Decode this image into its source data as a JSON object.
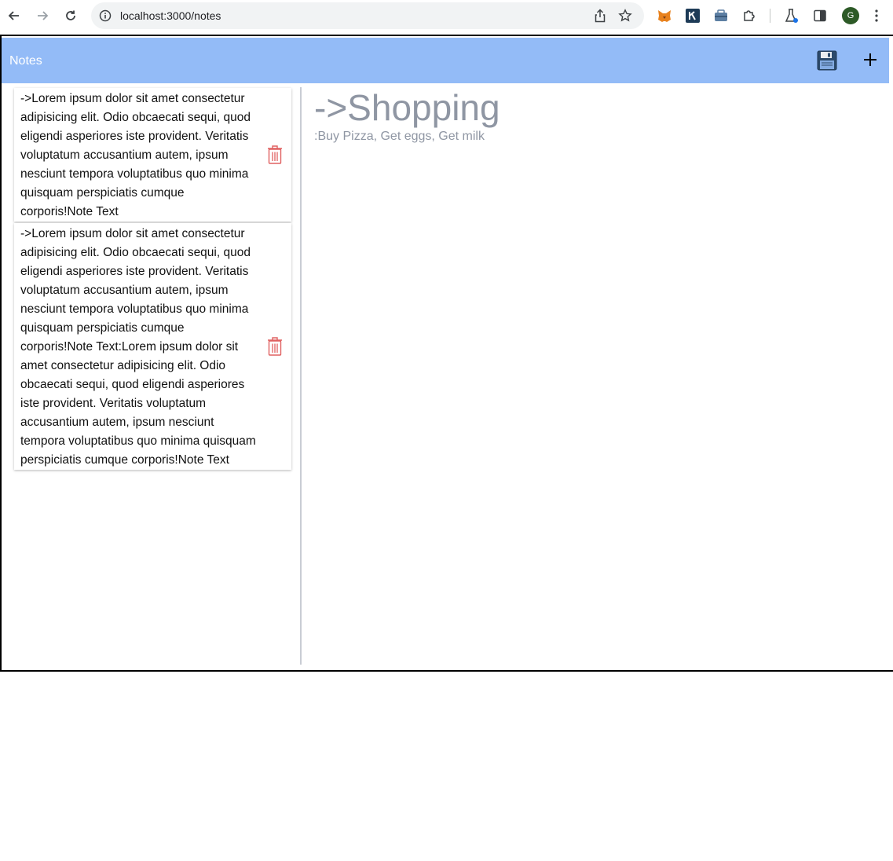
{
  "browser": {
    "url": "localhost:3000/notes",
    "avatar_letter": "G"
  },
  "app": {
    "title": "Notes"
  },
  "notes": [
    {
      "text": "->Lorem ipsum dolor sit amet consectetur adipisicing elit. Odio obcaecati sequi, quod eligendi asperiores iste provident. Veritatis voluptatum accusantium autem, ipsum nesciunt tempora voluptatibus quo minima quisquam perspiciatis cumque corporis!Note Text"
    },
    {
      "text": "->Lorem ipsum dolor sit amet consectetur adipisicing elit. Odio obcaecati sequi, quod eligendi asperiores iste provident. Veritatis voluptatum accusantium autem, ipsum nesciunt tempora voluptatibus quo minima quisquam perspiciatis cumque corporis!Note Text:Lorem ipsum dolor sit amet consectetur adipisicing elit. Odio obcaecati sequi, quod eligendi asperiores iste provident. Veritatis voluptatum accusantium autem, ipsum nesciunt tempora voluptatibus quo minima quisquam perspiciatis cumque corporis!Note Text"
    }
  ],
  "detail": {
    "title": "->Shopping",
    "body": ":Buy Pizza, Get eggs, Get milk"
  },
  "colors": {
    "header": "#93bbf7",
    "trash": "#e06060",
    "detail_text": "#8f96a3"
  }
}
